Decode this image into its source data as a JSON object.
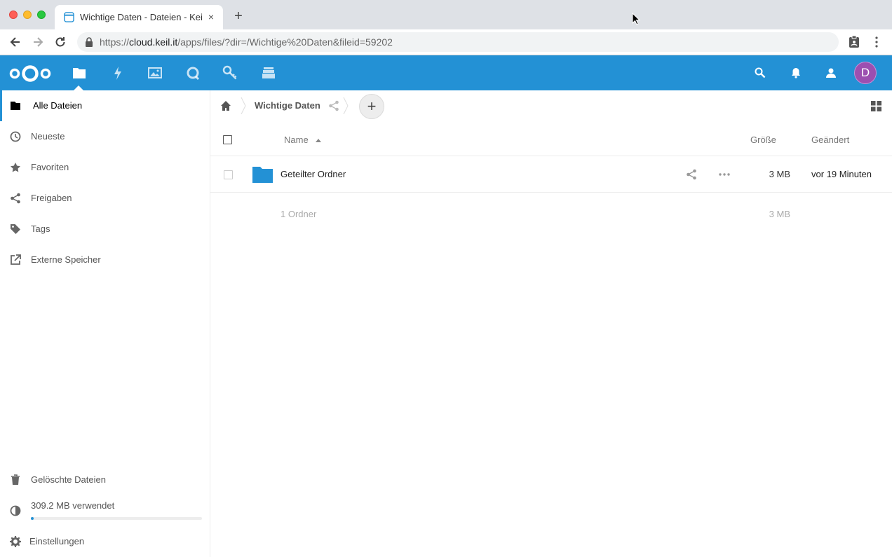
{
  "browser": {
    "tab_title": "Wichtige Daten - Dateien - Kei",
    "tab_close": "×",
    "new_tab": "+",
    "url_scheme": "https://",
    "url_host": "cloud.keil.it",
    "url_path": "/apps/files/?dir=/Wichtige%20Daten&fileid=59202"
  },
  "header": {
    "apps": [
      "files-icon",
      "activity-icon",
      "photos-icon",
      "talk-icon",
      "search-app-icon",
      "deck-icon"
    ],
    "avatar_initial": "D",
    "brand_color": "#2391d5"
  },
  "sidebar": {
    "items": [
      {
        "label": "Alle Dateien",
        "icon": "folder-icon"
      },
      {
        "label": "Neueste",
        "icon": "clock-icon"
      },
      {
        "label": "Favoriten",
        "icon": "star-icon"
      },
      {
        "label": "Freigaben",
        "icon": "share-icon"
      },
      {
        "label": "Tags",
        "icon": "tag-icon"
      },
      {
        "label": "Externe Speicher",
        "icon": "external-icon"
      }
    ],
    "trash_label": "Gelöschte Dateien",
    "quota_label": "309.2 MB verwendet",
    "quota_fraction": 0.01,
    "settings_label": "Einstellungen"
  },
  "breadcrumb": {
    "current": "Wichtige Daten",
    "add_label": "+"
  },
  "table": {
    "col_name": "Name",
    "col_size": "Größe",
    "col_modified": "Geändert",
    "rows": [
      {
        "name": "Geteilter Ordner",
        "size": "3 MB",
        "modified": "vor 19 Minuten"
      }
    ],
    "summary_count": "1 Ordner",
    "summary_size": "3 MB"
  }
}
